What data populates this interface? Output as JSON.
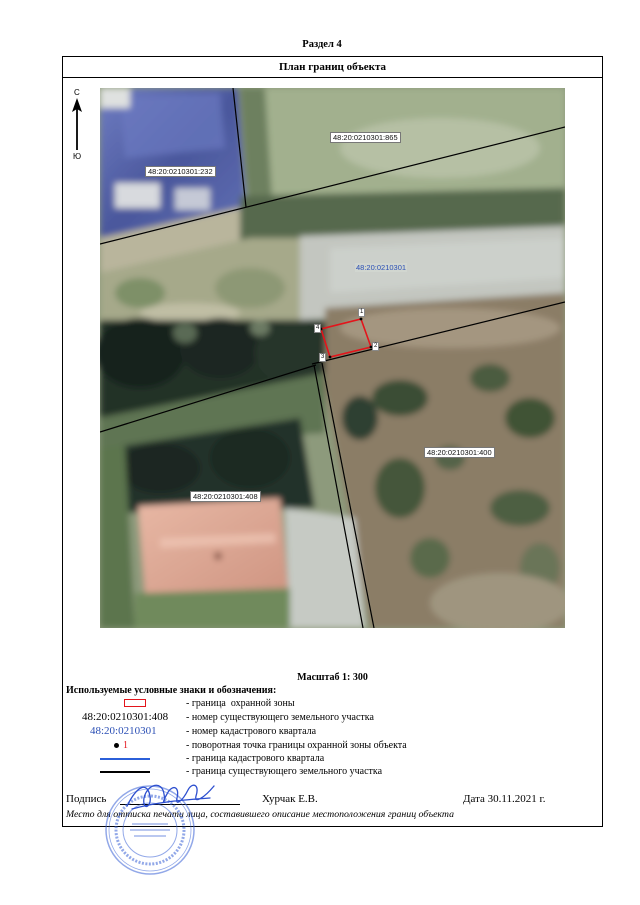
{
  "document": {
    "section_title": "Раздел 4",
    "plan_title": "План границ объекта"
  },
  "map": {
    "north_label": "С",
    "south_label": "Ю",
    "parcels": [
      "48:20:0210301:865",
      "48:20:0210301:232",
      "48:20:0210301:400",
      "48:20:0210301:408"
    ],
    "cadastral_quarter": "48:20:0210301",
    "zone_points": [
      "1",
      "2",
      "3",
      "4"
    ]
  },
  "scale": "Масштаб 1: 300",
  "legend": {
    "title": "Используемые условные знаки и обозначения:",
    "items": [
      {
        "symbol": "red-rectangle-icon",
        "text": "- граница  охранной зоны"
      },
      {
        "symbol": "parcel-number",
        "sample": "48:20:0210301:408",
        "text": "- номер существующего земельного участка"
      },
      {
        "symbol": "quarter-number",
        "sample": "48:20:0210301",
        "text": "- номер кадастрового квартала"
      },
      {
        "symbol": "turning-point-icon",
        "sample": "1",
        "text": "- поворотная точка границы охранной зоны объекта"
      },
      {
        "symbol": "blue-line-icon",
        "text": "- граница кадастрового квартала"
      },
      {
        "symbol": "black-line-icon",
        "text": "- граница существующего земельного участка"
      }
    ]
  },
  "signature": {
    "label": "Подпись",
    "name": "Хурчак Е.В.",
    "date": "Дата 30.11.2021 г."
  },
  "stamp_note": "Место для оттиска печати лица, составившего описание местоположения границ объекта",
  "colors": {
    "zone_boundary": "#e3141b",
    "quarter_number": "#2b4fb5",
    "quarter_line": "#2b5fd9",
    "parcel_line": "#000000",
    "stamp_ink": "#3a62d6"
  }
}
